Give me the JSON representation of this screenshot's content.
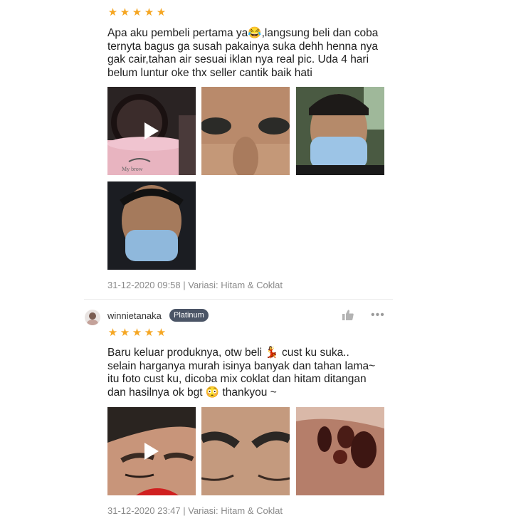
{
  "reviews": [
    {
      "rating": 5,
      "text": "Apa aku pembeli pertama ya😂,langsung beli dan coba\nternyta bagus ga susah pakainya suka dehh henna nya\ngak cair,tahan air sesuai iklan nya real pic. Uda 4 hari\nbelum luntur oke thx seller cantik baik hati",
      "meta": "31-12-2020 09:58 | Variasi: Hitam & Coklat"
    },
    {
      "username": "winnietanaka",
      "badge": "Platinum",
      "rating": 5,
      "text": "Baru keluar produknya, otw beli 💃 cust ku suka..\nselain harganya murah isinya banyak dan tahan lama~\nitu foto cust ku,  dicoba mix coklat dan hitam ditangan\ndan hasilnya ok bgt 😳  thankyou ~",
      "meta": "31-12-2020 23:47 | Variasi: Hitam & Coklat"
    }
  ],
  "icons": {
    "star": "star-icon",
    "play": "play-icon",
    "like": "thumbs-up-icon",
    "more": "more-icon"
  },
  "colors": {
    "star": "#f5a623",
    "badge_bg": "#4b5566",
    "meta_text": "#8a8a8a"
  }
}
